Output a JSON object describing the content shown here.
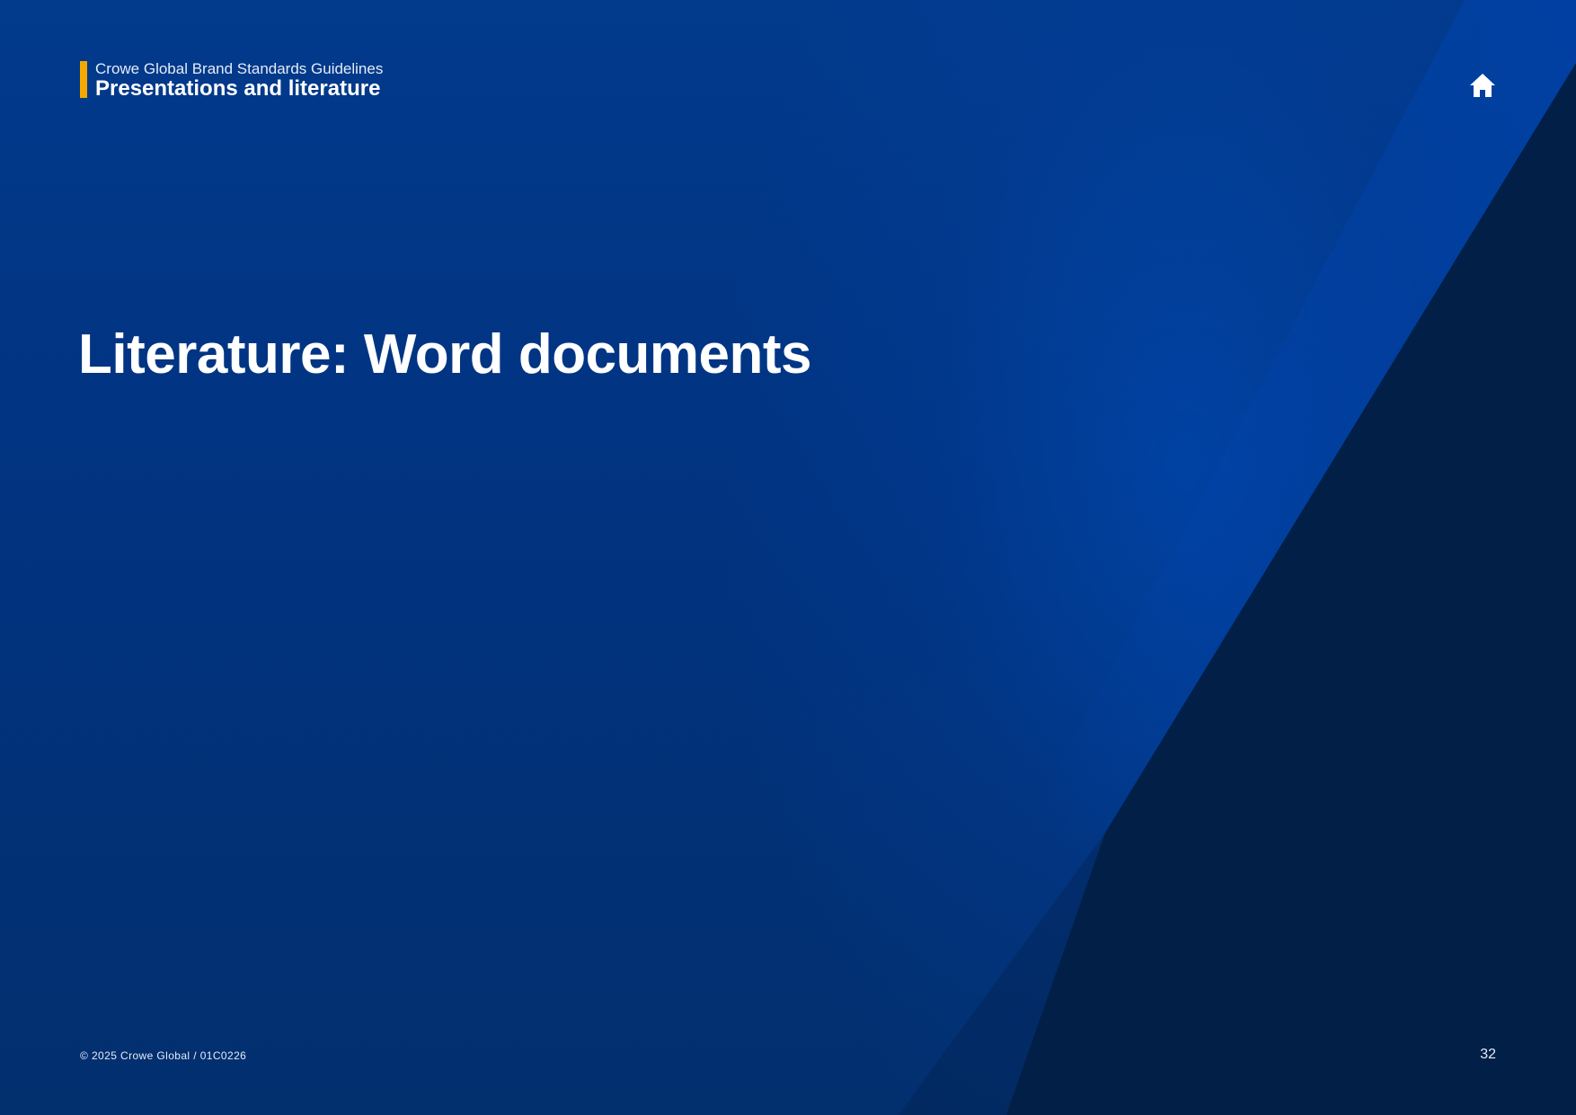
{
  "header": {
    "subtitle": "Crowe Global Brand Standards Guidelines",
    "section_title": "Presentations and literature"
  },
  "main": {
    "title": "Literature: Word documents"
  },
  "footer": {
    "copyright": "© 2025 Crowe Global  /  01C0226",
    "page_number": "32"
  },
  "icons": {
    "home": "home-icon"
  },
  "colors": {
    "background": "#013380",
    "triangle_dark": "#021f47",
    "accent": "#f5a800",
    "text": "#ffffff"
  }
}
